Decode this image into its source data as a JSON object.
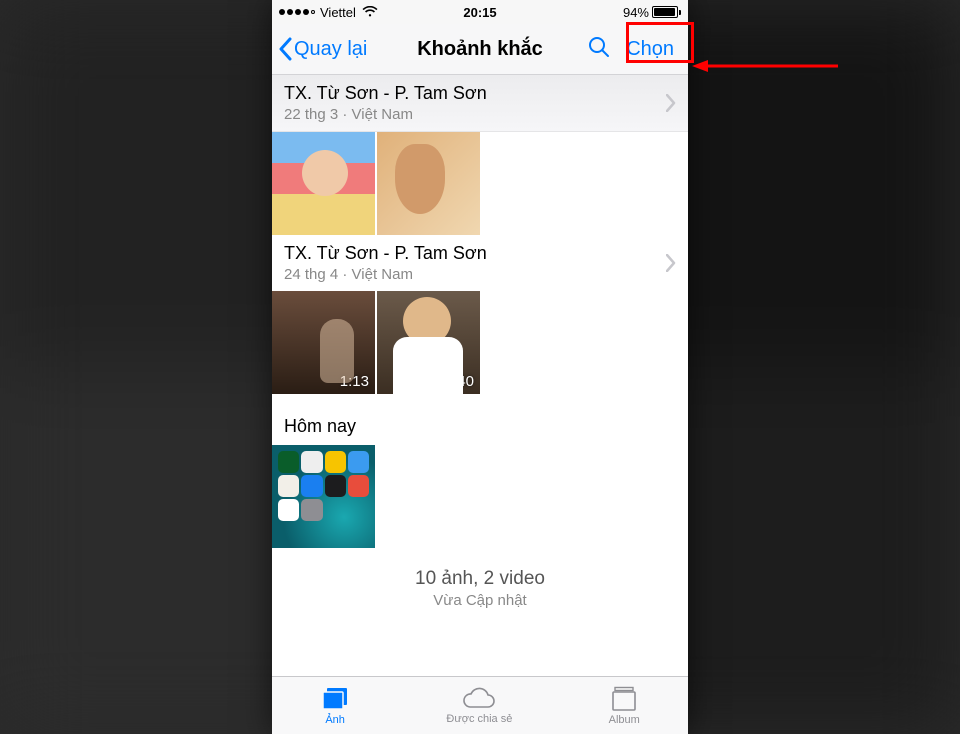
{
  "status_bar": {
    "carrier": "Viettel",
    "time": "20:15",
    "battery_pct": "94%"
  },
  "nav": {
    "back": "Quay lại",
    "title": "Khoảnh khắc",
    "select": "Chọn"
  },
  "moments": [
    {
      "title": "TX. Từ Sơn - P. Tam Sơn",
      "subtitle": "22 thg 3 · Việt Nam",
      "thumbs": [
        {},
        {}
      ]
    },
    {
      "title": "TX. Từ Sơn - P. Tam Sơn",
      "subtitle": "24 thg 4 · Việt Nam",
      "thumbs": [
        {
          "duration": "1:13"
        },
        {
          "duration": "0:40"
        }
      ]
    },
    {
      "title": "Hôm nay",
      "subtitle": "",
      "thumbs": [
        {}
      ]
    }
  ],
  "summary": {
    "main": "10 ảnh, 2 video",
    "sub": "Vừa Cập nhật"
  },
  "tabs": {
    "photos": "Ảnh",
    "shared": "Được chia sẻ",
    "album": "Album"
  }
}
